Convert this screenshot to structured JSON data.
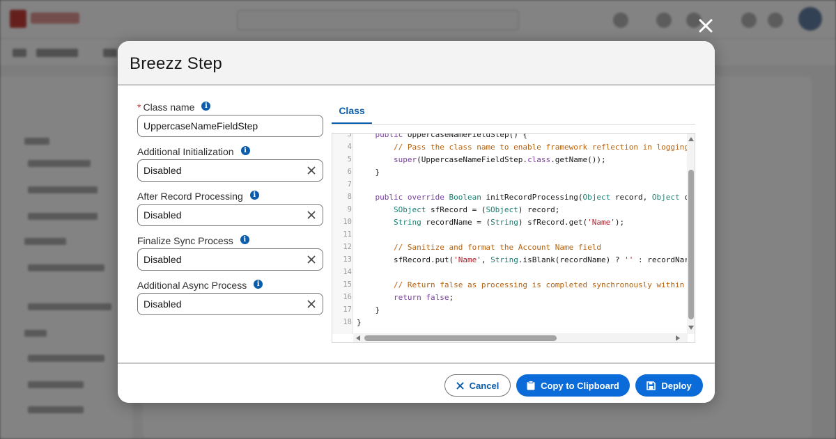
{
  "background_app": {},
  "modal": {
    "title": "Breezz Step",
    "close_label": "Close"
  },
  "form": {
    "class_name": {
      "label": "Class name",
      "required": true,
      "value": "UppercaseNameFieldStep"
    },
    "additional_initialization": {
      "label": "Additional Initialization",
      "value": "Disabled"
    },
    "after_record_processing": {
      "label": "After Record Processing",
      "value": "Disabled"
    },
    "finalize_sync_process": {
      "label": "Finalize Sync Process",
      "value": "Disabled"
    },
    "additional_async_process": {
      "label": "Additional Async Process",
      "value": "Disabled"
    }
  },
  "tabs": [
    {
      "label": "Class",
      "active": true
    }
  ],
  "code_lines": [
    {
      "n": "3",
      "text": "    public UppercaseNameFieldStep() {"
    },
    {
      "n": "4",
      "text": "        // Pass the class name to enable framework reflection in logging"
    },
    {
      "n": "5",
      "text": "        super(UppercaseNameFieldStep.class.getName());"
    },
    {
      "n": "6",
      "text": "    }"
    },
    {
      "n": "7",
      "text": ""
    },
    {
      "n": "8",
      "text": "    public override Boolean initRecordProcessing(Object record, Object c"
    },
    {
      "n": "9",
      "text": "        SObject sfRecord = (SObject) record;"
    },
    {
      "n": "10",
      "text": "        String recordName = (String) sfRecord.get('Name');"
    },
    {
      "n": "11",
      "text": ""
    },
    {
      "n": "12",
      "text": "        // Sanitize and format the Account Name field"
    },
    {
      "n": "13",
      "text": "        sfRecord.put('Name', String.isBlank(recordName) ? '' : recordNar"
    },
    {
      "n": "14",
      "text": ""
    },
    {
      "n": "15",
      "text": "        // Return false as processing is completed synchronously within"
    },
    {
      "n": "16",
      "text": "        return false;"
    },
    {
      "n": "17",
      "text": "    }"
    },
    {
      "n": "18",
      "text": "}"
    }
  ],
  "footer": {
    "cancel_label": "Cancel",
    "copy_label": "Copy to Clipboard",
    "deploy_label": "Deploy"
  },
  "colors": {
    "brand_blue": "#0b6bd8",
    "link_blue": "#0b5cab",
    "required_red": "#c23934"
  }
}
